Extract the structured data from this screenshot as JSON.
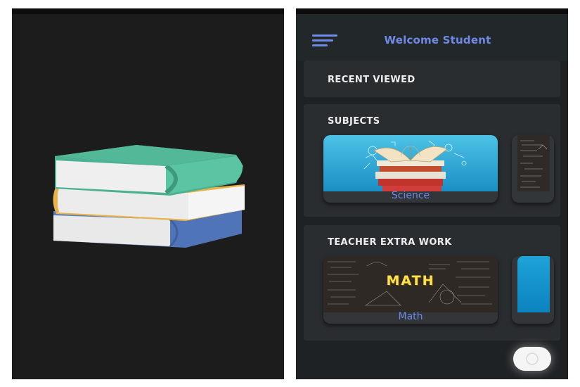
{
  "app": {
    "header_title": "Welcome Student"
  },
  "sections": {
    "recent": {
      "title": "RECENT VIEWED"
    },
    "subjects": {
      "title": "SUBJECTS",
      "tiles": [
        {
          "label": "Science",
          "image": "books-stack-illustration"
        },
        {
          "label": "",
          "image": "chalkboard-formulas"
        }
      ]
    },
    "teacher_work": {
      "title": "TEACHER EXTRA WORK",
      "tiles": [
        {
          "label": "Math",
          "image": "math-chalkboard",
          "board_text": "MATH"
        },
        {
          "label": "",
          "image": "blue-cover"
        }
      ]
    }
  },
  "icons": {
    "splash": "books-stack-icon",
    "menu": "hamburger-menu-icon",
    "fab": "floating-action-icon"
  },
  "colors": {
    "accent": "#6f89e6",
    "background": "#1f2224",
    "card": "#2a2d30",
    "splash_bg": "#1c1c1c"
  }
}
